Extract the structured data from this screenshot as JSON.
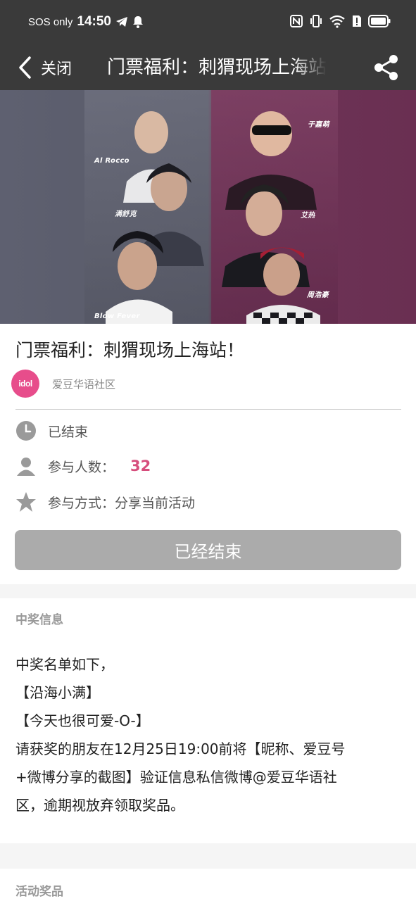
{
  "status_bar": {
    "carrier": "SOS only",
    "time": "14:50"
  },
  "nav": {
    "back_label": "关闭",
    "title": "门票福利：刺猬现场上海站！"
  },
  "banner": {
    "performers_left": [
      "Al Rocco",
      "满舒克",
      "Blow Fever"
    ],
    "performers_right": [
      "于嘉萌",
      "艾热",
      "周浩豪"
    ],
    "color_left": "#5e6070",
    "color_right": "#6e3557"
  },
  "event": {
    "title": "门票福利：刺猬现场上海站！",
    "organizer_logo_text": "idol",
    "organizer": "爱豆华语社区",
    "status": "已结束",
    "participants_label": "参与人数：",
    "participants_count": "32",
    "method": "参与方式：分享当前活动",
    "ended_button": "已经结束"
  },
  "winner_info": {
    "title": "中奖信息",
    "lines": [
      "中奖名单如下，",
      "【沿海小满】",
      "【今天也很可爱-O-】",
      "请获奖的朋友在12月25日19:00前将【昵称、爱豆号",
      "+微博分享的截图】验证信息私信微博@爱豆华语社",
      "区，逾期视放弃领取奖品。"
    ]
  },
  "prizes": {
    "title": "活动奖品"
  },
  "colors": {
    "bar_bg": "#3a3a3a",
    "accent": "#d64d7c",
    "button_disabled": "#ababab"
  }
}
